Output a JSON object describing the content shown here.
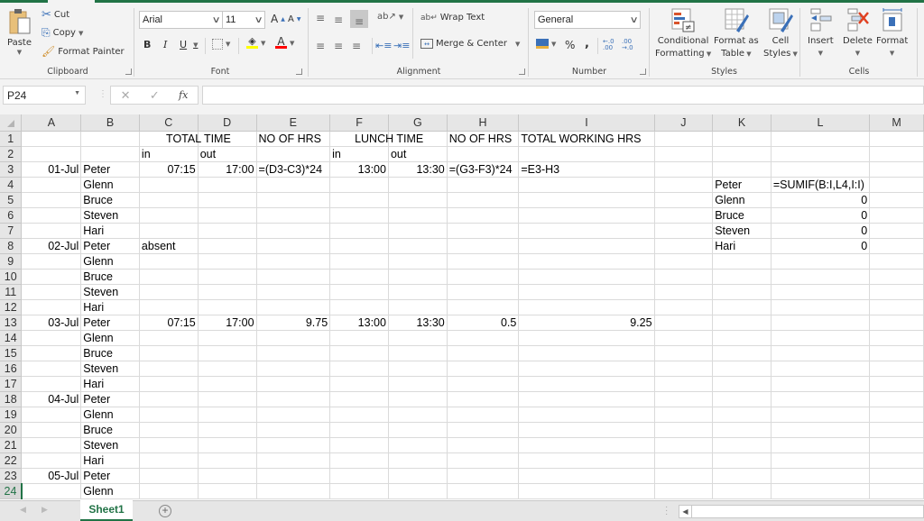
{
  "ribbon": {
    "clipboard": {
      "label": "Clipboard",
      "paste": "Paste",
      "cut": "Cut",
      "copy": "Copy",
      "format_painter": "Format Painter"
    },
    "font": {
      "label": "Font",
      "font_name": "Arial",
      "font_size": "11",
      "bold": "B",
      "italic": "I",
      "underline": "U",
      "grow": "A",
      "shrink": "A",
      "font_color_letter": "A",
      "highlight_color": "#ffff00",
      "font_color": "#ff0000"
    },
    "alignment": {
      "label": "Alignment",
      "wrap_text": "Wrap Text",
      "merge_center": "Merge & Center"
    },
    "number": {
      "label": "Number",
      "format": "General",
      "percent": "%",
      "comma": ","
    },
    "styles": {
      "label": "Styles",
      "conditional_formatting": [
        "Conditional",
        "Formatting"
      ],
      "format_as_table": [
        "Format as",
        "Table"
      ],
      "cell_styles": [
        "Cell",
        "Styles"
      ]
    },
    "cells": {
      "label": "Cells",
      "insert": "Insert",
      "delete": "Delete",
      "format": "Format"
    }
  },
  "formula_bar": {
    "name_box": "P24",
    "fx": "fx",
    "formula": ""
  },
  "grid": {
    "columns": [
      "A",
      "B",
      "C",
      "D",
      "E",
      "F",
      "G",
      "H",
      "I",
      "J",
      "K",
      "L",
      "M"
    ],
    "active_row": 24,
    "rows": [
      {
        "n": "1",
        "cells": {
          "C": "TOTAL TIME",
          "E": "NO OF HRS",
          "F": "LUNCH TIME",
          "H": "NO OF HRS",
          "I": "TOTAL WORKING HRS"
        }
      },
      {
        "n": "2",
        "cells": {
          "C": "in",
          "D": "out",
          "F": "in",
          "G": "out"
        }
      },
      {
        "n": "3",
        "cells": {
          "A": "01-Jul",
          "B": "Peter",
          "C": "07:15",
          "D": "17:00",
          "E": "=(D3-C3)*24",
          "F": "13:00",
          "G": "13:30",
          "H": "=(G3-F3)*24",
          "I": "=E3-H3"
        }
      },
      {
        "n": "4",
        "cells": {
          "B": "Glenn",
          "K": "Peter",
          "L": "=SUMIF(B:I,L4,I:I)"
        }
      },
      {
        "n": "5",
        "cells": {
          "B": "Bruce",
          "K": "Glenn",
          "L": "0"
        }
      },
      {
        "n": "6",
        "cells": {
          "B": "Steven",
          "K": "Bruce",
          "L": "0"
        }
      },
      {
        "n": "7",
        "cells": {
          "B": "Hari",
          "K": "Steven",
          "L": "0"
        }
      },
      {
        "n": "8",
        "cells": {
          "A": "02-Jul",
          "B": "Peter",
          "C": "absent",
          "K": "Hari",
          "L": "0"
        }
      },
      {
        "n": "9",
        "cells": {
          "B": "Glenn"
        }
      },
      {
        "n": "10",
        "cells": {
          "B": "Bruce"
        }
      },
      {
        "n": "11",
        "cells": {
          "B": "Steven"
        }
      },
      {
        "n": "12",
        "cells": {
          "B": "Hari"
        }
      },
      {
        "n": "13",
        "cells": {
          "A": "03-Jul",
          "B": "Peter",
          "C": "07:15",
          "D": "17:00",
          "E": "9.75",
          "F": "13:00",
          "G": "13:30",
          "H": "0.5",
          "I": "9.25"
        }
      },
      {
        "n": "14",
        "cells": {
          "B": "Glenn"
        }
      },
      {
        "n": "15",
        "cells": {
          "B": "Bruce"
        }
      },
      {
        "n": "16",
        "cells": {
          "B": "Steven"
        }
      },
      {
        "n": "17",
        "cells": {
          "B": "Hari"
        }
      },
      {
        "n": "18",
        "cells": {
          "A": "04-Jul",
          "B": "Peter"
        }
      },
      {
        "n": "19",
        "cells": {
          "B": "Glenn"
        }
      },
      {
        "n": "20",
        "cells": {
          "B": "Bruce"
        }
      },
      {
        "n": "21",
        "cells": {
          "B": "Steven"
        }
      },
      {
        "n": "22",
        "cells": {
          "B": "Hari"
        }
      },
      {
        "n": "23",
        "cells": {
          "A": "05-Jul",
          "B": "Peter"
        }
      },
      {
        "n": "24",
        "cells": {
          "B": "Glenn"
        }
      }
    ]
  },
  "sheet_tabs": {
    "tabs": [
      "Sheet1"
    ],
    "active": "Sheet1",
    "add_label": "+"
  },
  "colors": {
    "accent": "#217346"
  }
}
